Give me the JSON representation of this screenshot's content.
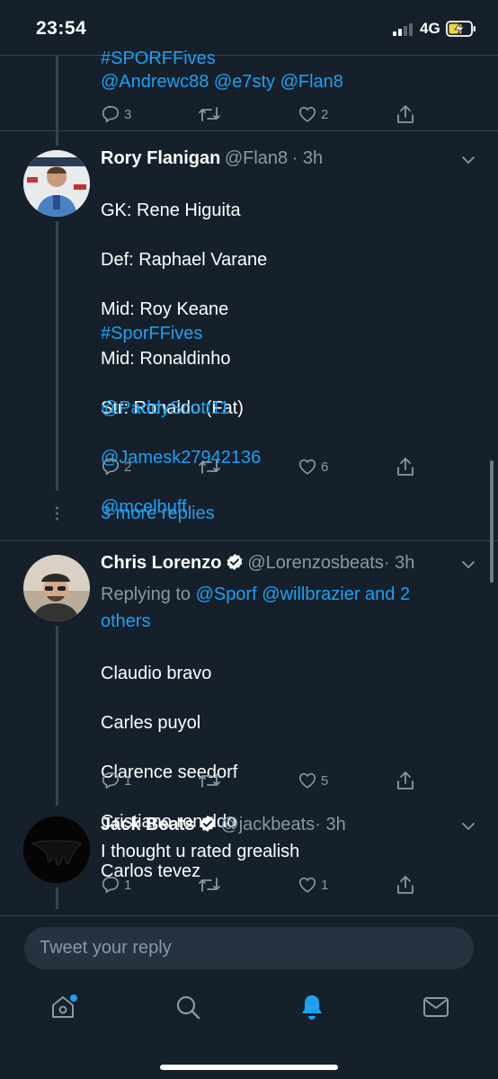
{
  "status_bar": {
    "time": "23:54",
    "network": "4G"
  },
  "tweets": [
    {
      "hashtag_line": "#SPORFFives",
      "mentions_line": "@Andrewc88 @e7sty @Flan8",
      "replies": "3",
      "retweets": "",
      "likes": "2"
    },
    {
      "name": "Rory Flanigan",
      "handle": "@Flan8",
      "time": "· 3h",
      "lines": [
        "GK: Rene Higuita",
        "Def: Raphael Varane",
        "Mid: Roy Keane",
        "Mid: Ronaldinho",
        "Str: Ronaldo (Fat)"
      ],
      "hashtag": "#SporFFives",
      "mentions": [
        "@PaddyScott11",
        "@Jamesk27942136",
        "@mcelbuff"
      ],
      "replies": "2",
      "retweets": "",
      "likes": "6"
    }
  ],
  "more_replies": "3 more replies",
  "tweet3": {
    "name": "Chris Lorenzo",
    "handle": "@Lorenzosbeats",
    "time": "· 3h",
    "replying_prefix": "Replying to",
    "replying_users": "@Sporf @willbrazier and 2",
    "replying_others": "others",
    "lines": [
      "Claudio bravo",
      "Carles puyol",
      "Clarence seedorf",
      "Cristiano ronaldo",
      "Carlos tevez"
    ],
    "replies": "1",
    "retweets": "",
    "likes": "5"
  },
  "tweet4": {
    "name": "Jack Beats",
    "handle": "@jackbeats",
    "time": "· 3h",
    "text": "I thought u rated grealish",
    "replies": "1",
    "retweets": "",
    "likes": "1"
  },
  "reply_input": {
    "placeholder": "Tweet your reply"
  },
  "tab_bar": {
    "active": "notifications"
  },
  "colors": {
    "background": "#15202b",
    "accent": "#1da1f2",
    "muted": "#8899a6",
    "divider": "#38444d"
  }
}
